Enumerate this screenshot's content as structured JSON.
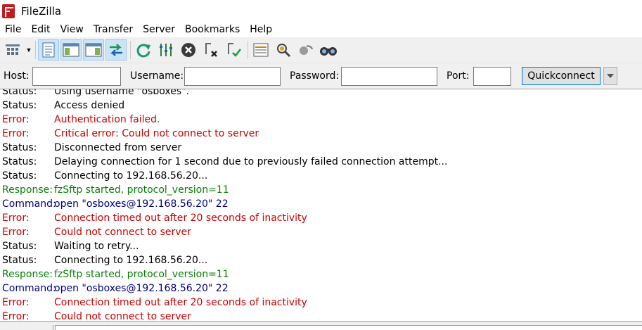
{
  "window": {
    "title": "FileZilla"
  },
  "menu": [
    "File",
    "Edit",
    "View",
    "Transfer",
    "Server",
    "Bookmarks",
    "Help"
  ],
  "toolbar": {
    "buttons": [
      "site-manager-icon",
      "toggle-message-log-icon",
      "toggle-local-tree-icon",
      "toggle-remote-tree-icon",
      "toggle-transfer-queue-icon",
      "refresh-icon",
      "process-queue-icon",
      "cancel-icon",
      "disconnect-icon",
      "reconnect-icon",
      "directory-filter-icon",
      "toggle-sync-browsing-icon",
      "sync-browsing-icon",
      "search-icon"
    ]
  },
  "quickconnect": {
    "host_label": "Host:",
    "username_label": "Username:",
    "password_label": "Password:",
    "port_label": "Port:",
    "host_value": "",
    "username_value": "",
    "password_value": "",
    "port_value": "",
    "button_label": "Quickconnect"
  },
  "log": [
    {
      "type": "Status:",
      "kind": "status",
      "message": "Using username \"osboxes\"."
    },
    {
      "type": "Status:",
      "kind": "status",
      "message": "Access denied"
    },
    {
      "type": "Error:",
      "kind": "error",
      "message": "Authentication failed."
    },
    {
      "type": "Error:",
      "kind": "error",
      "message": "Critical error: Could not connect to server"
    },
    {
      "type": "Status:",
      "kind": "status",
      "message": "Disconnected from server"
    },
    {
      "type": "Status:",
      "kind": "status",
      "message": "Delaying connection for 1 second due to previously failed connection attempt..."
    },
    {
      "type": "Status:",
      "kind": "status",
      "message": "Connecting to 192.168.56.20..."
    },
    {
      "type": "Response:",
      "kind": "response",
      "message": "fzSftp started, protocol_version=11"
    },
    {
      "type": "Command:",
      "kind": "command",
      "message": "open \"osboxes@192.168.56.20\" 22"
    },
    {
      "type": "Error:",
      "kind": "error",
      "message": "Connection timed out after 20 seconds of inactivity"
    },
    {
      "type": "Error:",
      "kind": "error",
      "message": "Could not connect to server"
    },
    {
      "type": "Status:",
      "kind": "status",
      "message": "Waiting to retry..."
    },
    {
      "type": "Status:",
      "kind": "status",
      "message": "Connecting to 192.168.56.20..."
    },
    {
      "type": "Response:",
      "kind": "response",
      "message": "fzSftp started, protocol_version=11"
    },
    {
      "type": "Command:",
      "kind": "command",
      "message": "open \"osboxes@192.168.56.20\" 22"
    },
    {
      "type": "Error:",
      "kind": "error",
      "message": "Connection timed out after 20 seconds of inactivity"
    },
    {
      "type": "Error:",
      "kind": "error",
      "message": "Could not connect to server"
    }
  ],
  "colors": {
    "status": "#000000",
    "error": "#c80000",
    "response": "#0a7d0a",
    "command": "#00007f"
  }
}
